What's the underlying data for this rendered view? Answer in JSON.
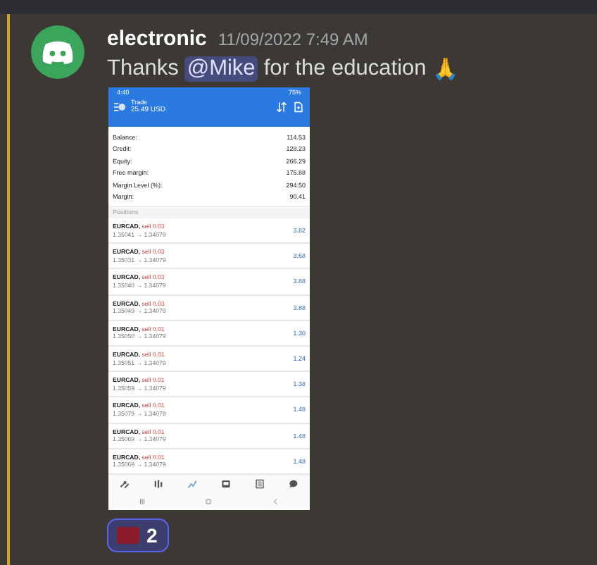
{
  "message": {
    "author": "electronic",
    "timestamp": "11/09/2022 7:49 AM",
    "text_before": "Thanks",
    "mention": "@Mike",
    "text_after": "for the education",
    "emoji": "🙏"
  },
  "attachment": {
    "kind": "screenshot",
    "status_time": "4:40",
    "battery": "75%",
    "header_title": "Trade",
    "header_subtitle": "25.49 USD",
    "summary": [
      {
        "label": "Balance:",
        "value": "114.53"
      },
      {
        "label": "Credit:",
        "value": "128.23"
      },
      {
        "label": "Equity:",
        "value": "266.29"
      },
      {
        "label": "Free margin:",
        "value": "175.88"
      },
      {
        "label": "Margin Level (%):",
        "value": "294.50"
      },
      {
        "label": "Margin:",
        "value": "90.41"
      }
    ],
    "section_title": "Positions",
    "positions": [
      {
        "symbol": "EURCAD,",
        "side": "sell 0.03",
        "prices": "1.35041 → 1.34079",
        "profit": "3.82"
      },
      {
        "symbol": "EURCAD,",
        "side": "sell 0.03",
        "prices": "1.35031 → 1.34079",
        "profit": "3.68"
      },
      {
        "symbol": "EURCAD,",
        "side": "sell 0.03",
        "prices": "1.35040 → 1.34079",
        "profit": "3.88"
      },
      {
        "symbol": "EURCAD,",
        "side": "sell 0.03",
        "prices": "1.35049 → 1.34079",
        "profit": "3.88"
      },
      {
        "symbol": "EURCAD,",
        "side": "sell 0.01",
        "prices": "1.35050 → 1.34079",
        "profit": "1.30"
      },
      {
        "symbol": "EURCAD,",
        "side": "sell 0.01",
        "prices": "1.35051 → 1.34079",
        "profit": "1.24"
      },
      {
        "symbol": "EURCAD,",
        "side": "sell 0.01",
        "prices": "1.35059 → 1.34079",
        "profit": "1.38"
      },
      {
        "symbol": "EURCAD,",
        "side": "sell 0.01",
        "prices": "1.35079 → 1.34079",
        "profit": "1.48"
      },
      {
        "symbol": "EURCAD,",
        "side": "sell 0.01",
        "prices": "1.35069 → 1.34079",
        "profit": "1.48"
      },
      {
        "symbol": "EURCAD,",
        "side": "sell 0.01",
        "prices": "1.35069 → 1.34079",
        "profit": "1.48"
      }
    ],
    "nav": [
      {
        "kind": "quotes",
        "selected": false
      },
      {
        "kind": "chart",
        "selected": false
      },
      {
        "kind": "trade",
        "selected": true
      },
      {
        "kind": "history",
        "selected": false
      },
      {
        "kind": "news",
        "selected": false
      },
      {
        "kind": "chat",
        "selected": false
      }
    ]
  },
  "reaction": {
    "count": "2"
  }
}
